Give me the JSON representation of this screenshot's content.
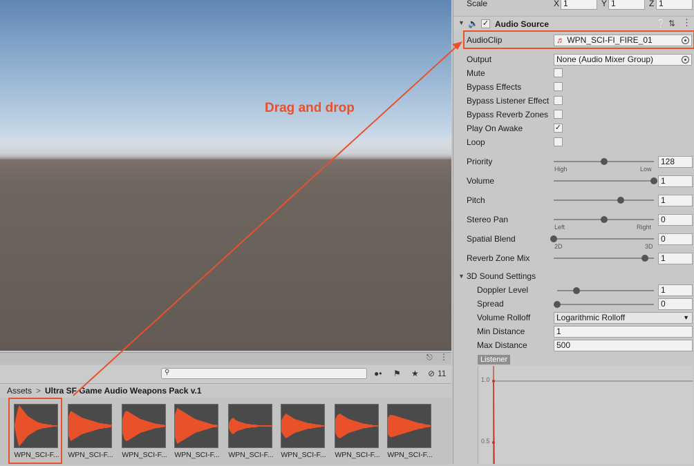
{
  "annotation": {
    "text": "Drag and drop",
    "color": "#e8512a"
  },
  "project": {
    "breadcrumb": {
      "root": "Assets",
      "separator": ">",
      "folder": "Ultra SF Game Audio Weapons Pack v.1"
    },
    "visible_count": "11",
    "search_placeholder": "",
    "assets": [
      {
        "label": "WPN_SCI-F..."
      },
      {
        "label": "WPN_SCI-F..."
      },
      {
        "label": "WPN_SCI-F..."
      },
      {
        "label": "WPN_SCI-F..."
      },
      {
        "label": "WPN_SCI-F..."
      },
      {
        "label": "WPN_SCI-F..."
      },
      {
        "label": "WPN_SCI-F..."
      },
      {
        "label": "WPN_SCI-F..."
      }
    ],
    "waveform_color": "#e8512a"
  },
  "inspector": {
    "transform": {
      "label": "Scale",
      "x_label": "X",
      "x": "1",
      "y_label": "Y",
      "y": "1",
      "z_label": "Z",
      "z": "1"
    },
    "audio_source": {
      "title": "Audio Source",
      "enabled": true,
      "audioclip": {
        "label": "AudioClip",
        "value": "WPN_SCI-FI_FIRE_01"
      },
      "output": {
        "label": "Output",
        "value": "None (Audio Mixer Group)"
      },
      "mute": {
        "label": "Mute",
        "checked": false
      },
      "bypass_effects": {
        "label": "Bypass Effects",
        "checked": false
      },
      "bypass_listener": {
        "label": "Bypass Listener Effect",
        "checked": false
      },
      "bypass_reverb": {
        "label": "Bypass Reverb Zones",
        "checked": false
      },
      "play_on_awake": {
        "label": "Play On Awake",
        "checked": true
      },
      "loop": {
        "label": "Loop",
        "checked": false
      },
      "priority": {
        "label": "Priority",
        "value": "128",
        "min_label": "High",
        "max_label": "Low",
        "level": 0.5
      },
      "volume": {
        "label": "Volume",
        "value": "1",
        "level": 1.0
      },
      "pitch": {
        "label": "Pitch",
        "value": "1",
        "level": 0.67
      },
      "stereo_pan": {
        "label": "Stereo Pan",
        "value": "0",
        "min_label": "Left",
        "max_label": "Right",
        "level": 0.5
      },
      "spatial_blend": {
        "label": "Spatial Blend",
        "value": "0",
        "min_label": "2D",
        "max_label": "3D",
        "level": 0.0
      },
      "reverb_zone_mix": {
        "label": "Reverb Zone Mix",
        "value": "1",
        "level": 0.91
      },
      "sound3d": {
        "title": "3D Sound Settings",
        "doppler": {
          "label": "Doppler Level",
          "value": "1",
          "level": 0.2
        },
        "spread": {
          "label": "Spread",
          "value": "0",
          "level": 0.0
        },
        "rolloff": {
          "label": "Volume Rolloff",
          "value": "Logarithmic Rolloff"
        },
        "min_distance": {
          "label": "Min Distance",
          "value": "1"
        },
        "max_distance": {
          "label": "Max Distance",
          "value": "500"
        }
      },
      "graph": {
        "tag": "Listener",
        "y_top": "1.0",
        "y_mid": "0.5"
      }
    }
  }
}
